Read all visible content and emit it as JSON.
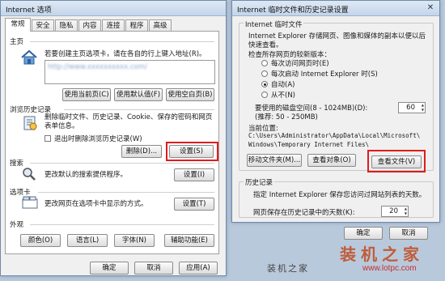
{
  "left": {
    "title": "Internet 选项",
    "tabs": [
      "常规",
      "安全",
      "隐私",
      "内容",
      "连接",
      "程序",
      "高级"
    ],
    "home": {
      "heading": "主页",
      "desc": "若要创建主页选项卡，请在各自的行上键入地址(R)。",
      "url": "http://www.xxxxxxxxxx.com/",
      "btn_current": "使用当前页(C)",
      "btn_default": "使用默认值(F)",
      "btn_blank": "使用空白页(B)"
    },
    "history": {
      "heading": "浏览历史记录",
      "desc": "删除临时文件、历史记录、Cookie、保存的密码和网页表单信息。",
      "checkbox": "退出时删除浏览历史记录(W)",
      "btn_delete": "删除(D)...",
      "btn_settings": "设置(S)"
    },
    "search": {
      "heading": "搜索",
      "desc": "更改默认的搜索提供程序。",
      "btn": "设置(I)"
    },
    "tabsgroup": {
      "heading": "选项卡",
      "desc": "更改网页在选项卡中显示的方式。",
      "btn": "设置(T)"
    },
    "appearance": {
      "heading": "外观",
      "btn_colors": "颜色(O)",
      "btn_lang": "语言(L)",
      "btn_fonts": "字体(N)",
      "btn_access": "辅助功能(E)"
    },
    "footer": {
      "ok": "确定",
      "cancel": "取消",
      "apply": "应用(A)"
    }
  },
  "right": {
    "title": "Internet 临时文件和历史记录设置",
    "temp": {
      "heading": "Internet 临时文件",
      "desc1": "Internet Explorer 存储网页、图像和媒体的副本以便以后",
      "desc2": "快速查看。",
      "check_label": "检查所存网页的较新版本：",
      "options": [
        "每次访问网页时(E)",
        "每次启动 Internet Explorer 时(S)",
        "自动(A)",
        "从不(N)"
      ],
      "selected": 2,
      "disk_label1": "要使用的磁盘空间(8 - 1024MB)(D):",
      "disk_label2": "(推荐: 50 - 250MB)",
      "disk_value": "60",
      "location_label": "当前位置:",
      "location_path1": "C:\\Users\\Administrator\\AppData\\Local\\Microsoft\\",
      "location_path2": "Windows\\Temporary Internet Files\\",
      "btn_move": "移动文件夹(M)...",
      "btn_objects": "查看对象(O)",
      "btn_files": "查看文件(V)"
    },
    "history": {
      "heading": "历史记录",
      "desc": "指定 Internet Explorer 保存您访问过网站列表的天数。",
      "days_label": "网页保存在历史记录中的天数(K):",
      "days_value": "20"
    },
    "footer": {
      "ok": "确定",
      "cancel": "取消"
    }
  },
  "watermark": {
    "brand": "装机之家",
    "site": "www.lotpc.com"
  }
}
